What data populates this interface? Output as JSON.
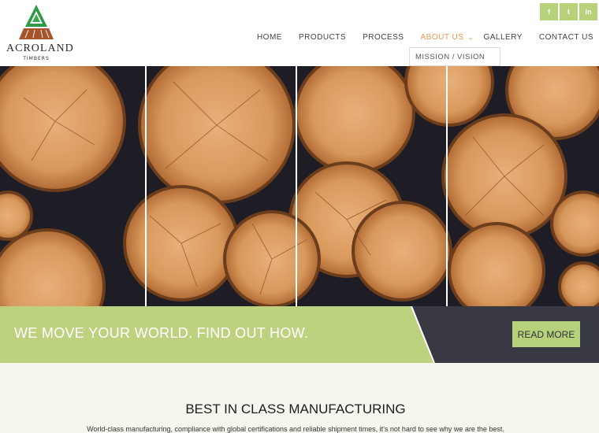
{
  "brand": {
    "name": "ACROLAND",
    "sub": "TIMBERS"
  },
  "social": [
    {
      "icon": "facebook-icon",
      "glyph": "f"
    },
    {
      "icon": "twitter-icon",
      "glyph": "t"
    },
    {
      "icon": "linkedin-icon",
      "glyph": "in"
    }
  ],
  "nav": {
    "home": "HOME",
    "products": "PRODUCTS",
    "process": "PROCESS",
    "about": "ABOUT US",
    "gallery": "GALLERY",
    "contact": "CONTACT US",
    "dropdown_item": "MISSION / VISION"
  },
  "banner": {
    "headline": "WE MOVE YOUR WORLD. FIND OUT HOW.",
    "button": "READ MORE"
  },
  "section": {
    "title": "BEST IN CLASS MANUFACTURING",
    "text": "World-class manufacturing, compliance with global certifications and reliable shipment times, it's not hard to see why we are the best."
  },
  "colors": {
    "accent_green": "#b8d27b",
    "active_orange": "#e39a4f",
    "dark_panel": "#393943",
    "section_bg": "#f7f6ee"
  }
}
